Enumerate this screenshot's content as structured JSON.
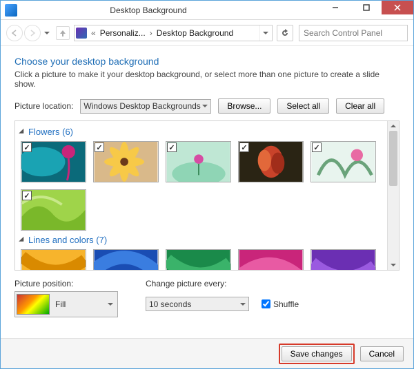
{
  "window": {
    "title": "Desktop Background"
  },
  "breadcrumb": {
    "item1": "Personaliz...",
    "item2": "Desktop Background"
  },
  "search": {
    "placeholder": "Search Control Panel"
  },
  "main": {
    "heading": "Choose your desktop background",
    "subhead": "Click a picture to make it your desktop background, or select more than one picture to create a slide show."
  },
  "picture_location": {
    "label": "Picture location:",
    "value": "Windows Desktop Backgrounds",
    "browse": "Browse...",
    "select_all": "Select all",
    "clear_all": "Clear all"
  },
  "groups": {
    "flowers": {
      "title": "Flowers (6)"
    },
    "lines": {
      "title": "Lines and colors (7)"
    }
  },
  "thumbs_checked": [
    "✓",
    "✓",
    "✓",
    "✓",
    "✓",
    "✓"
  ],
  "picture_position": {
    "label": "Picture position:",
    "value": "Fill"
  },
  "change_every": {
    "label": "Change picture every:",
    "value": "10 seconds"
  },
  "shuffle": {
    "label": "Shuffle",
    "checked": true
  },
  "footer": {
    "save": "Save changes",
    "cancel": "Cancel"
  }
}
